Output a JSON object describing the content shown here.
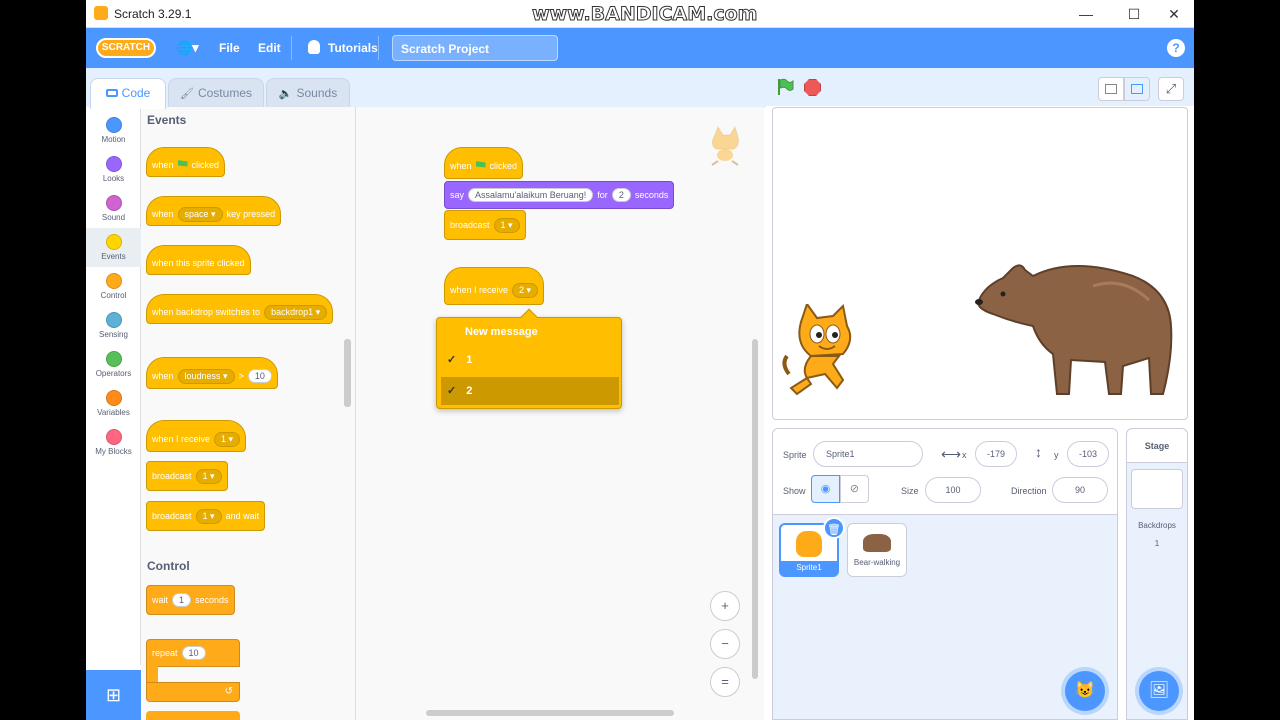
{
  "window": {
    "title": "Scratch 3.29.1",
    "watermark": "www.BANDICAM.com",
    "minimize": "—",
    "maximize": "☐",
    "close": "✕"
  },
  "menubar": {
    "logo": "SCRATCH",
    "globe": "🌐▾",
    "file": "File",
    "edit": "Edit",
    "tutorials": "Tutorials",
    "project_title": "Scratch Project",
    "help": "?"
  },
  "tabs": {
    "code": "Code",
    "costumes": "Costumes",
    "sounds": "Sounds"
  },
  "categories": [
    {
      "label": "Motion",
      "color": "#4c97ff"
    },
    {
      "label": "Looks",
      "color": "#9966ff"
    },
    {
      "label": "Sound",
      "color": "#cf63cf"
    },
    {
      "label": "Events",
      "color": "#ffd500"
    },
    {
      "label": "Control",
      "color": "#ffab19"
    },
    {
      "label": "Sensing",
      "color": "#5cb1d6"
    },
    {
      "label": "Operators",
      "color": "#59c059"
    },
    {
      "label": "Variables",
      "color": "#ff8c1a"
    },
    {
      "label": "My Blocks",
      "color": "#ff6680"
    }
  ],
  "palette": {
    "events_title": "Events",
    "control_title": "Control",
    "when": "when",
    "clicked": "clicked",
    "space": "space",
    "key_pressed": "key pressed",
    "when_sprite_clicked": "when this sprite clicked",
    "when_backdrop_switches": "when backdrop switches to",
    "backdrop1": "backdrop1",
    "loudness": "loudness",
    "gt": ">",
    "ten": "10",
    "when_i_receive": "when I receive",
    "one": "1",
    "broadcast": "broadcast",
    "and_wait": "and wait",
    "wait": "wait",
    "seconds": "seconds",
    "repeat": "repeat"
  },
  "script": {
    "when": "when",
    "clicked": "clicked",
    "say": "say",
    "say_text": "Assalamu'alaikum Beruang!",
    "for": "for",
    "say_secs": "2",
    "seconds": "seconds",
    "broadcast": "broadcast",
    "broadcast_val": "1",
    "when_i_receive": "when I receive",
    "receive_val": "2"
  },
  "dropdown": {
    "items": [
      "New message",
      "1",
      "2"
    ],
    "check": "✓"
  },
  "zoom": {
    "in": "+",
    "out": "−",
    "reset": "="
  },
  "sprite_info": {
    "sprite_label": "Sprite",
    "sprite_name": "Sprite1",
    "x_label": "x",
    "x_val": "-179",
    "y_label": "y",
    "y_val": "-103",
    "show_label": "Show",
    "size_label": "Size",
    "size_val": "100",
    "direction_label": "Direction",
    "direction_val": "90"
  },
  "sprites": [
    {
      "name": "Sprite1"
    },
    {
      "name": "Bear-walking"
    }
  ],
  "stage_panel": {
    "title": "Stage",
    "backdrops_label": "Backdrops",
    "backdrops_count": "1"
  }
}
